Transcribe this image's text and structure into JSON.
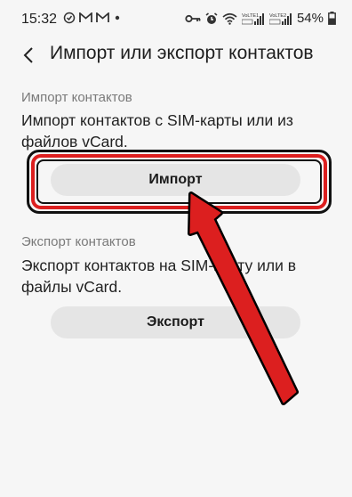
{
  "status_bar": {
    "time": "15:32",
    "left_icons": [
      "sync-icon",
      "gmail-icon",
      "gmail-icon",
      "dot-icon"
    ],
    "right_icons": [
      "key-icon",
      "alarm-icon",
      "wifi-icon",
      "signal-volte-lte1-icon",
      "signal-volte-lte2-icon",
      "battery-icon"
    ],
    "sim1_label": "VoLTE1",
    "sim2_label": "VoLTE2",
    "battery": "54%"
  },
  "header": {
    "title": "Импорт или экспорт контактов"
  },
  "import_section": {
    "heading": "Импорт контактов",
    "description": "Импорт контактов с SIM-карты или из файлов vCard.",
    "button_label": "Импорт"
  },
  "export_section": {
    "heading": "Экспорт контактов",
    "description": "Экспорт контактов на SIM-карту или в файлы vCard.",
    "button_label": "Экспорт"
  },
  "colors": {
    "background": "#f6f6f6",
    "highlight_red": "#dc1f1f",
    "button_bg": "#e5e5e5"
  }
}
